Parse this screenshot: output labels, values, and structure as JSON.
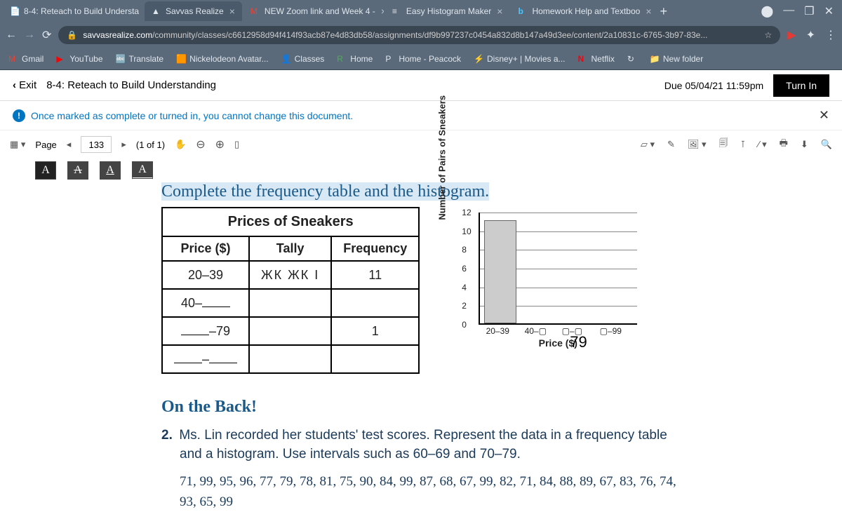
{
  "browser": {
    "tabs": [
      {
        "label": "8-4: Reteach to Build Understa"
      },
      {
        "label": "Savvas Realize"
      },
      {
        "label": "NEW Zoom link and Week 4 -"
      },
      {
        "label": "Easy Histogram Maker"
      },
      {
        "label": "Homework Help and Textboo"
      }
    ],
    "url_prefix": "savvasrealize.com",
    "url_rest": "/community/classes/c6612958d94f414f93acb87e4d83db58/assignments/df9b997237c0454a832d8b147a49d3ee/content/2a10831c-6765-3b97-83e..."
  },
  "bookmarks": [
    "Gmail",
    "YouTube",
    "Translate",
    "Nickelodeon Avatar...",
    "Classes",
    "Home",
    "Home - Peacock",
    "Disney+ | Movies a...",
    "Netflix",
    "New folder"
  ],
  "app": {
    "exit": "Exit",
    "title": "8-4: Reteach to Build Understanding",
    "due": "Due 05/04/21 11:59pm",
    "turn_in": "Turn In",
    "warning": "Once marked as complete or turned in, you cannot change this document."
  },
  "toolbar": {
    "page_label": "Page",
    "page_num": "133",
    "page_total": "(1 of 1)"
  },
  "content": {
    "instruction": "Complete the frequency table and the histogram.",
    "table": {
      "title": "Prices of Sneakers",
      "headers": [
        "Price ($)",
        "Tally",
        "Frequency"
      ],
      "rows": [
        {
          "price": "20–39",
          "tally": "ЖК ЖК I",
          "freq": "11"
        },
        {
          "price_prefix": "40–",
          "price_suffix": "",
          "tally": "",
          "freq": ""
        },
        {
          "price_prefix": "",
          "price_suffix": "–79",
          "tally": "",
          "freq": "1"
        },
        {
          "price_prefix": "",
          "price_suffix": "–",
          "tally": "",
          "freq": ""
        }
      ]
    },
    "typed_answer": "79",
    "on_back": "On the Back!",
    "q2_num": "2.",
    "q2_text": "Ms. Lin recorded her students' test scores. Represent the data in a frequency table and a histogram. Use intervals such as 60–69 and 70–79.",
    "q2_data": "71, 99, 95, 96, 77, 79, 78, 81, 75, 90, 84, 99, 87, 68, 67, 99, 82, 71, 84, 88, 89, 67, 83, 76, 74, 93, 65, 99"
  },
  "chart_data": {
    "type": "bar",
    "title": "",
    "xlabel": "Price ($)",
    "ylabel": "Number of Pairs of Sneakers",
    "categories": [
      "20–39",
      "40–",
      "",
      "–99"
    ],
    "values": [
      11,
      null,
      null,
      null
    ],
    "ylim": [
      0,
      12
    ],
    "y_ticks": [
      0,
      2,
      4,
      6,
      8,
      10,
      12
    ]
  }
}
